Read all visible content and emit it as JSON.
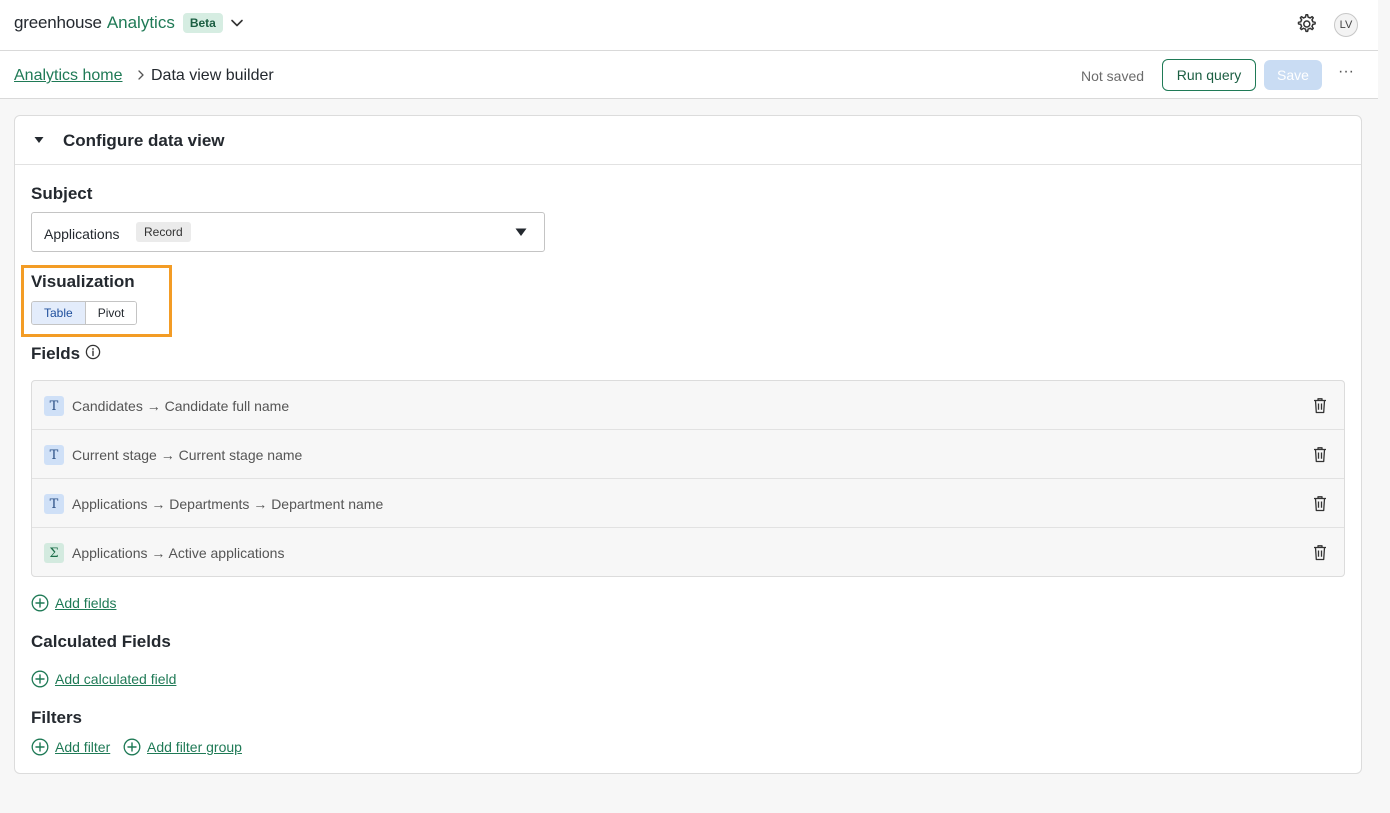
{
  "header": {
    "brand_primary": "greenhouse",
    "brand_secondary": "Analytics",
    "beta_badge": "Beta",
    "avatar_initials": "LV"
  },
  "breadcrumb": {
    "home": "Analytics home",
    "current": "Data view builder"
  },
  "toolbar": {
    "status": "Not saved",
    "run_label": "Run query",
    "save_label": "Save",
    "more_label": "···"
  },
  "panel": {
    "title": "Configure data view"
  },
  "subject": {
    "label": "Subject",
    "value": "Applications",
    "tag": "Record"
  },
  "visualization": {
    "label": "Visualization",
    "options": [
      "Table",
      "Pivot"
    ],
    "selected": "Table"
  },
  "fields": {
    "label": "Fields",
    "items": [
      {
        "type": "text",
        "type_glyph": "T",
        "label": "Candidates → Candidate full name"
      },
      {
        "type": "text",
        "type_glyph": "T",
        "label": "Current stage → Current stage name"
      },
      {
        "type": "text",
        "type_glyph": "T",
        "label": "Applications → Departments → Department name"
      },
      {
        "type": "sum",
        "type_glyph": "Σ",
        "label": "Applications → Active applications"
      }
    ],
    "add_label": "Add fields"
  },
  "calculated_fields": {
    "label": "Calculated Fields",
    "add_label": "Add calculated field"
  },
  "filters": {
    "label": "Filters",
    "add_filter_label": "Add filter",
    "add_group_label": "Add filter group"
  },
  "colors": {
    "brand_green": "#1f7a56",
    "highlight_orange": "#f39c25",
    "save_disabled": "#c9dcf3"
  }
}
